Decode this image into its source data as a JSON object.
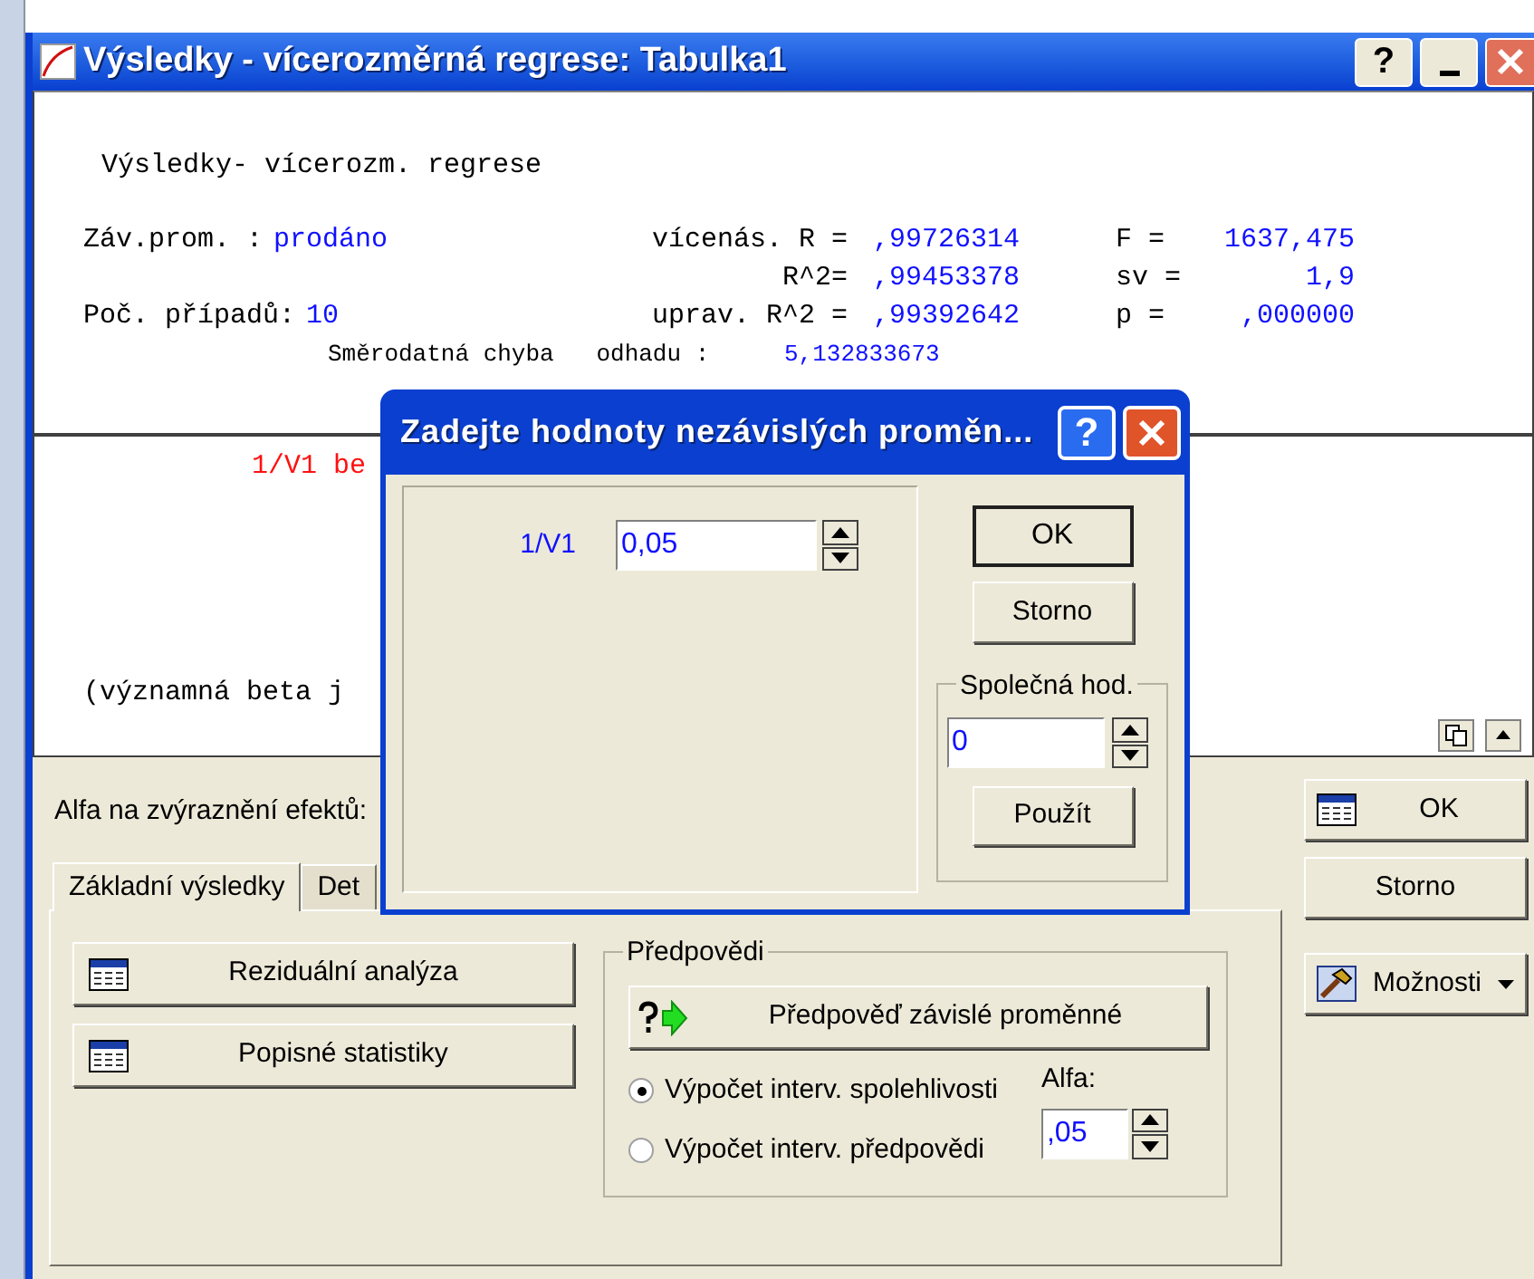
{
  "window": {
    "title": "Výsledky - vícerozměrná regrese: Tabulka1",
    "help": "?"
  },
  "results": {
    "heading": "Výsledky- vícerozm. regrese",
    "variables": [
      {
        "label": "Záv.prom. :",
        "value": "prodáno"
      },
      {
        "label": "Poč. případů:",
        "value": "10"
      }
    ],
    "fit": [
      {
        "label": "vícenás. R =",
        "value": ",99726314"
      },
      {
        "label": "R^2=",
        "value": ",99453378"
      },
      {
        "label": "uprav. R^2 =",
        "value": ",99392642"
      }
    ],
    "tests": [
      {
        "label": "F =",
        "value": "1637,475"
      },
      {
        "label": "sv =",
        "value": "1,9"
      },
      {
        "label": "p =",
        "value": ",000000"
      }
    ],
    "std_error": {
      "label": "Směrodatná chyba   odhadu :",
      "value": "5,132833673"
    },
    "beta_line": {
      "text": "1/V1 be",
      "kind": "highlight"
    },
    "note": "(významná beta j"
  },
  "panel": {
    "alpha_label": "Alfa na zvýraznění efektů:",
    "tabs": [
      {
        "label": "Základní výsledky",
        "selected": true
      },
      {
        "label": "Det",
        "selected": false
      }
    ],
    "buttons": [
      "Reziduální analýza",
      "Popisné statistiky"
    ],
    "group": {
      "title": "Předpovědi",
      "predict_button": "Předpověď závislé proměnné",
      "radios": [
        {
          "label": "Výpočet interv. spolehlivosti",
          "selected": true
        },
        {
          "label": "Výpočet interv. předpovědi",
          "selected": false
        }
      ],
      "alfa_label": "Alfa:",
      "alfa_value": ",05"
    },
    "side_buttons": [
      {
        "label": "OK",
        "kind": "ok"
      },
      {
        "label": "Storno",
        "kind": "plain"
      },
      {
        "label": "Možnosti",
        "kind": "menu"
      }
    ]
  },
  "dialog": {
    "title": "Zadejte hodnoty nezávislých proměn...",
    "help": "?",
    "variables": [
      {
        "name": "1/V1",
        "value": "0,05"
      }
    ],
    "ok": "OK",
    "cancel": "Storno",
    "common": {
      "title": "Společná hod.",
      "value": "0",
      "apply": "Použít"
    }
  }
}
